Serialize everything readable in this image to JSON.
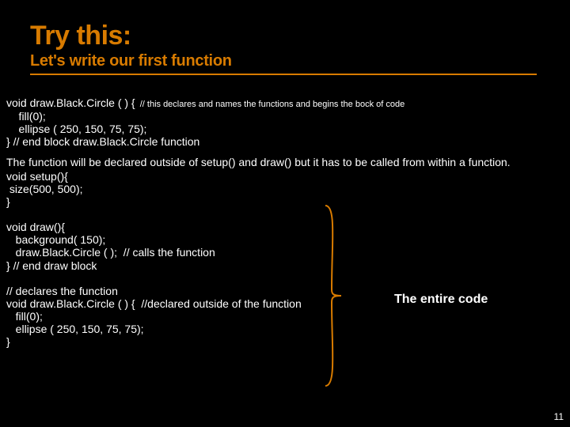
{
  "title": "Try this:",
  "subtitle": "Let's write our first function",
  "snippet1": {
    "line1_a": "void draw.Black.Circle ( ) {",
    "line1_comment": "  // this declares and names the functions and begins the bock of code",
    "line2": "    fill(0);",
    "line3": "    ellipse ( 250, 150, 75, 75);",
    "line4": "} // end block draw.Black.Circle function"
  },
  "explain": "The function will be declared outside of setup() and draw() but it has to be called from within a function.",
  "snippet2": "void setup(){\n size(500, 500);\n}",
  "snippet3": "void draw(){\n   background( 150);\n   draw.Black.Circle ( );  // calls the function\n} // end draw block",
  "snippet4": "// declares the function\nvoid draw.Black.Circle ( ) {  //declared outside of the function\n   fill(0);\n   ellipse ( 250, 150, 75, 75);\n}",
  "callout": "The entire code",
  "page": "11"
}
